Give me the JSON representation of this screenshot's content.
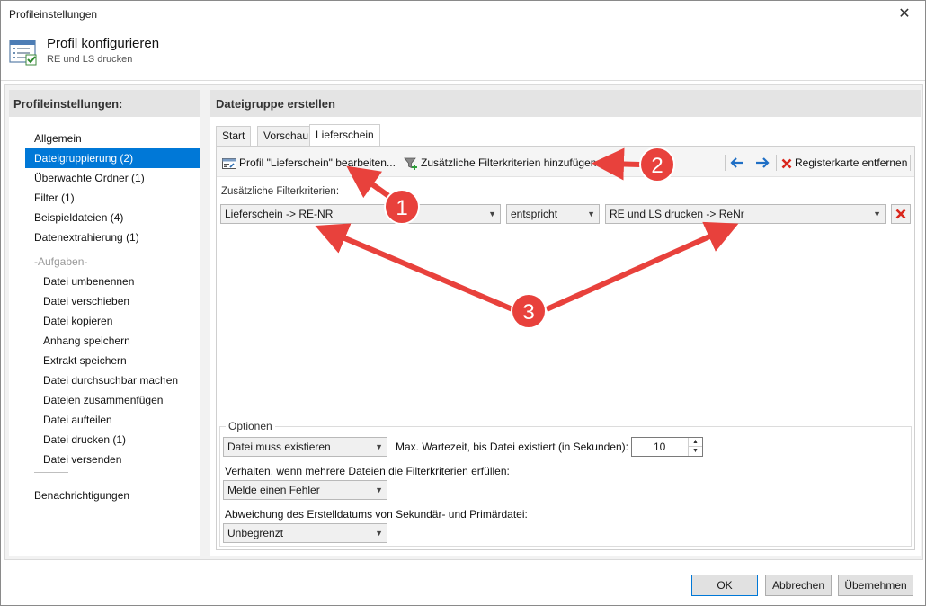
{
  "window": {
    "title": "Profileinstellungen",
    "close_glyph": "✕"
  },
  "header": {
    "title": "Profil konfigurieren",
    "subtitle": "RE und LS drucken",
    "icon": "profile-config-icon"
  },
  "sidebar": {
    "heading": "Profileinstellungen:",
    "items": [
      {
        "label": "Allgemein"
      },
      {
        "label": "Dateigruppierung (2)",
        "selected": true
      },
      {
        "label": "Überwachte Ordner (1)"
      },
      {
        "label": "Filter (1)"
      },
      {
        "label": "Beispieldateien (4)"
      },
      {
        "label": "Datenextrahierung (1)"
      }
    ],
    "section_label": "-Aufgaben-",
    "tasks": [
      {
        "label": "Datei umbenennen"
      },
      {
        "label": "Datei verschieben"
      },
      {
        "label": "Datei kopieren"
      },
      {
        "label": "Anhang speichern"
      },
      {
        "label": "Extrakt speichern"
      },
      {
        "label": "Datei durchsuchbar machen"
      },
      {
        "label": "Dateien zusammenfügen"
      },
      {
        "label": "Datei aufteilen"
      },
      {
        "label": "Datei drucken (1)"
      },
      {
        "label": "Datei versenden"
      }
    ],
    "footer_item": "Benachrichtigungen"
  },
  "panel": {
    "heading": "Dateigruppe erstellen",
    "tabs": [
      {
        "label": "Start"
      },
      {
        "label": "Vorschau"
      },
      {
        "label": "Lieferschein",
        "active": true
      }
    ],
    "toolbar": {
      "edit_profile": "Profil \"Lieferschein\" bearbeiten...",
      "add_filter": "Zusätzliche Filterkriterien hinzufügen",
      "remove_tab": "Registerkarte entfernen"
    },
    "filter_label": "Zusätzliche Filterkriterien:",
    "filter_row": {
      "field": "Lieferschein -> RE-NR",
      "operator": "entspricht",
      "value": "RE und LS drucken -> ReNr"
    },
    "options": {
      "legend": "Optionen",
      "file_mode": "Datei muss existieren",
      "wait_label": "Max. Wartezeit, bis Datei existiert (in Sekunden):",
      "wait_value": "10",
      "behaviour_label": "Verhalten, wenn mehrere Dateien die Filterkriterien erfüllen:",
      "behaviour_value": "Melde einen Fehler",
      "deviation_label": "Abweichung des Erstelldatums von Sekundär- und Primärdatei:",
      "deviation_value": "Unbegrenzt"
    }
  },
  "footer": {
    "ok": "OK",
    "cancel": "Abbrechen",
    "apply": "Übernehmen"
  },
  "annotations": [
    {
      "number": "1"
    },
    {
      "number": "2"
    },
    {
      "number": "3"
    }
  ],
  "colors": {
    "selection": "#0078d7",
    "arrow": "#e8413c",
    "delete_red": "#d9261c",
    "nav_arrow_blue": "#1f6fc5"
  }
}
